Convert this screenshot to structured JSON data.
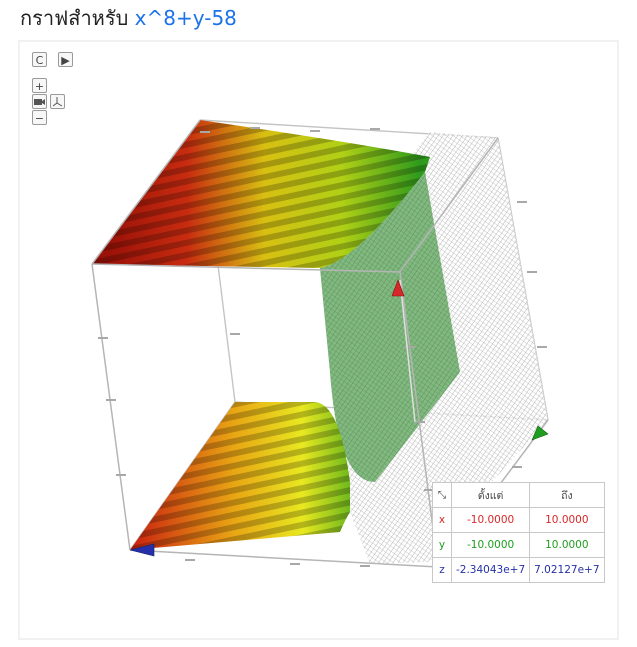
{
  "header": {
    "prefix": "กราฟสำหรับ",
    "expression": "x^8+y-58"
  },
  "controls": {
    "reset_icon": "C",
    "play_icon": "▶",
    "zoom_in": "+",
    "zoom_out": "−",
    "camera_icon": "camera-icon",
    "axes_icon": "axes-icon"
  },
  "range_table": {
    "corner_icon": "⤡",
    "col_from": "ตั้งแต่",
    "col_to": "ถึง",
    "rows": [
      {
        "axis": "x",
        "from": "-10.0000",
        "to": "10.0000",
        "color": "#d62828"
      },
      {
        "axis": "y",
        "from": "-10.0000",
        "to": "10.0000",
        "color": "#1f9d1f"
      },
      {
        "axis": "z",
        "from": "-2.34043e+7",
        "to": "7.02127e+7",
        "color": "#2530a8"
      }
    ]
  },
  "colors": {
    "expression": "#1a73e8",
    "x_axis": "#d62828",
    "y_axis": "#1f9d1f",
    "z_axis": "#2530a8"
  }
}
